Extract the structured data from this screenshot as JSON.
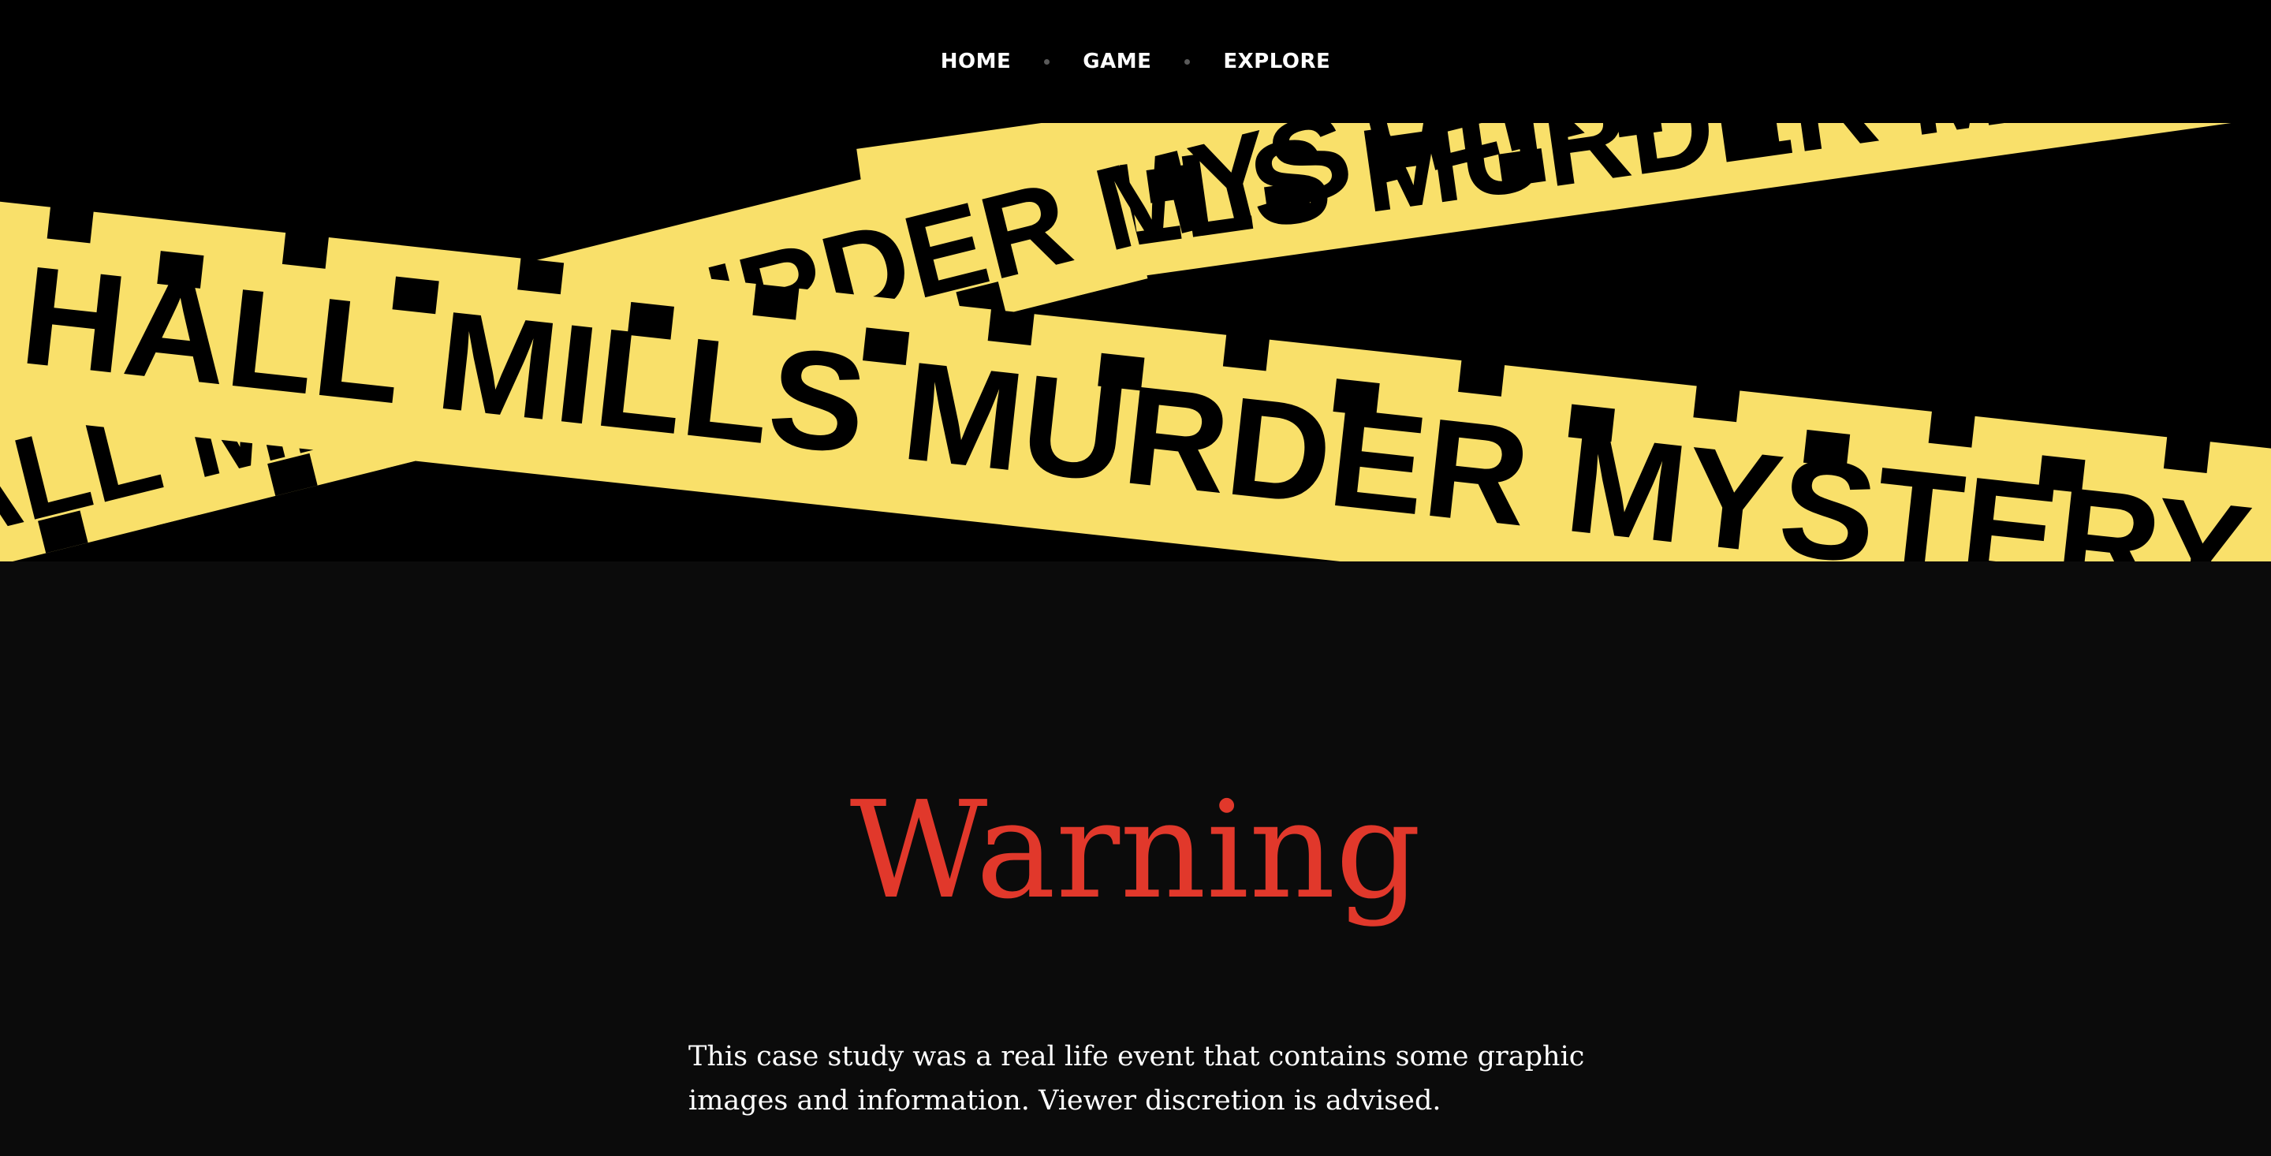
{
  "nav": {
    "items": [
      {
        "label": "HOME"
      },
      {
        "label": "GAME"
      },
      {
        "label": "EXPLORE"
      }
    ]
  },
  "banner": {
    "tape_text": "HALL MILLS MURDER MYSTERY",
    "colors": {
      "tape": "#f9e06a",
      "ink": "#000000"
    }
  },
  "warning": {
    "title": "Warning",
    "body": "This case study was a real life event that contains some graphic images and information. Viewer discretion is advised.",
    "title_color": "#e1382b"
  }
}
